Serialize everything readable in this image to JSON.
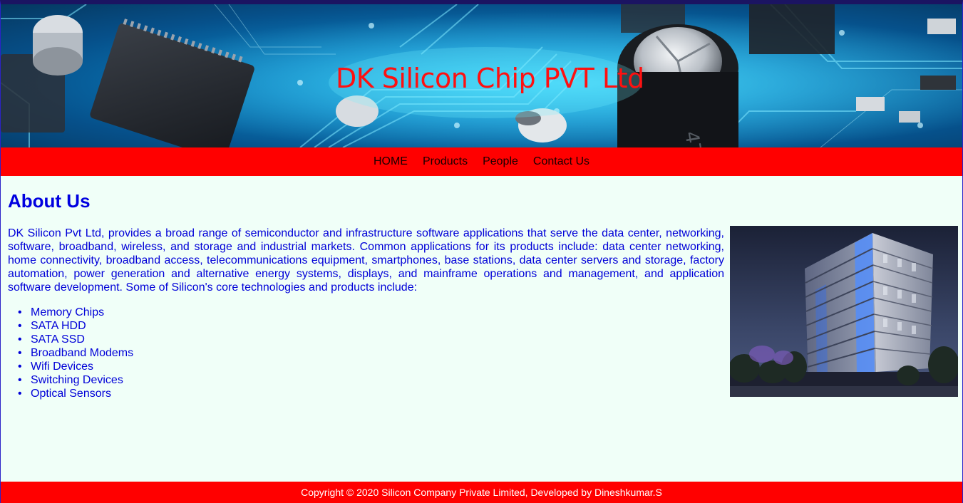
{
  "header": {
    "title": "DK Silicon Chip PVT Ltd",
    "banner_image": "circuit-board-image"
  },
  "nav": {
    "items": [
      {
        "label": "HOME"
      },
      {
        "label": "Products"
      },
      {
        "label": "People"
      },
      {
        "label": "Contact Us"
      }
    ]
  },
  "main": {
    "heading": "About Us",
    "paragraph": "DK Silicon Pvt Ltd, provides a broad range of semiconductor and infrastructure software applications that serve the data center, networking, software, broadband, wireless, and storage and industrial markets. Common applications for its products include: data center networking, home connectivity, broadband access, telecommunications equipment, smartphones, base stations, data center servers and storage, factory automation, power generation and alternative energy systems, displays, and mainframe operations and management, and application software development. Some of Silicon's core technologies and products include:",
    "products": [
      "Memory Chips",
      "SATA HDD",
      "SATA SSD",
      "Broadband Modems",
      "Wifi Devices",
      "Switching Devices",
      "Optical Sensors"
    ],
    "side_image": "office-building-image"
  },
  "footer": {
    "text": "Copyright © 2020 Silicon Company Private Limited, Developed by Dineshkumar.S"
  },
  "colors": {
    "accent": "#ff0000",
    "text": "#0000d8",
    "background": "#f0fff8",
    "title": "#ff1010"
  }
}
